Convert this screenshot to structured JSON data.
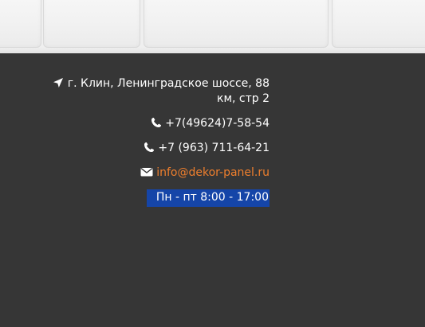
{
  "contacts": {
    "address_line1": "г. Клин, Ленинградское шоссе, 88",
    "address_line2": "км, стр 2",
    "phone1": "+7(49624)7-58-54",
    "phone2": "+7 (963) 711-64-21",
    "email": "info@dekor-panel.ru",
    "hours": "Пн - пт 8:00 - 17:00"
  },
  "icons": {
    "address": "location-arrow-icon",
    "phone1": "phone-icon",
    "phone2": "phone-icon",
    "email": "envelope-icon"
  },
  "colors": {
    "background": "#363636",
    "text": "#ffffff",
    "link": "#ef7f2d",
    "hours_highlight": "#1545a8"
  }
}
